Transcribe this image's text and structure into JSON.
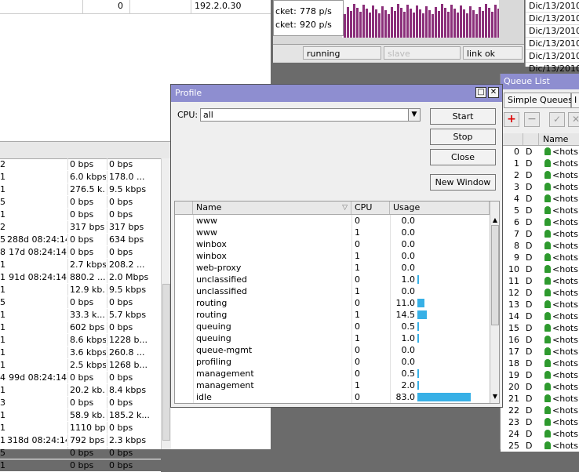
{
  "left_window": {
    "top_row": {
      "count": "0",
      "address": "192.2.0.30"
    },
    "rows": [
      {
        "id": "2",
        "uptime": "",
        "tx": "0 bps",
        "rx": "0 bps"
      },
      {
        "id": "1",
        "uptime": "",
        "tx": "6.0 kbps",
        "rx": "178.0 ..."
      },
      {
        "id": "1",
        "uptime": "",
        "tx": "276.5 k...",
        "rx": "9.5 kbps"
      },
      {
        "id": "5",
        "uptime": "",
        "tx": "0 bps",
        "rx": "0 bps"
      },
      {
        "id": "1",
        "uptime": "",
        "tx": "0 bps",
        "rx": "0 bps"
      },
      {
        "id": "2",
        "uptime": "",
        "tx": "317 bps",
        "rx": "317 bps"
      },
      {
        "id": "5",
        "uptime": "288d 08:24:14",
        "tx": "0 bps",
        "rx": "634 bps"
      },
      {
        "id": "8",
        "uptime": "17d 08:24:14",
        "tx": "0 bps",
        "rx": "0 bps"
      },
      {
        "id": "1",
        "uptime": "",
        "tx": "2.7 kbps",
        "rx": "208.2 ..."
      },
      {
        "id": "1",
        "uptime": "91d 08:24:14",
        "tx": "880.2 ...",
        "rx": "2.0 Mbps"
      },
      {
        "id": "1",
        "uptime": "",
        "tx": "12.9 kb...",
        "rx": "9.5 kbps"
      },
      {
        "id": "5",
        "uptime": "",
        "tx": "0 bps",
        "rx": "0 bps"
      },
      {
        "id": "1",
        "uptime": "",
        "tx": "33.3 k...",
        "rx": "5.7 kbps"
      },
      {
        "id": "1",
        "uptime": "",
        "tx": "602 bps",
        "rx": "0 bps"
      },
      {
        "id": "1",
        "uptime": "",
        "tx": "8.6 kbps",
        "rx": "1228 b..."
      },
      {
        "id": "1",
        "uptime": "",
        "tx": "3.6 kbps",
        "rx": "260.8 ..."
      },
      {
        "id": "1",
        "uptime": "",
        "tx": "2.5 kbps",
        "rx": "1268 b..."
      },
      {
        "id": "4",
        "uptime": "99d 08:24:14",
        "tx": "0 bps",
        "rx": "0 bps"
      },
      {
        "id": "1",
        "uptime": "",
        "tx": "20.2 kb...",
        "rx": "8.4 kbps"
      },
      {
        "id": "3",
        "uptime": "",
        "tx": "0 bps",
        "rx": "0 bps"
      },
      {
        "id": "1",
        "uptime": "",
        "tx": "58.9 kb...",
        "rx": "185.2 k..."
      },
      {
        "id": "1",
        "uptime": "",
        "tx": "1110 bps",
        "rx": "0 bps"
      },
      {
        "id": "1",
        "uptime": "318d 08:24:14",
        "tx": "792 bps",
        "rx": "2.3 kbps"
      },
      {
        "id": "5",
        "uptime": "",
        "tx": "0 bps",
        "rx": "0 bps"
      },
      {
        "id": "1",
        "uptime": "",
        "tx": "0 bps",
        "rx": "0 bps"
      }
    ]
  },
  "graph_window": {
    "legend": [
      {
        "label": "cket:",
        "value": "778 p/s"
      },
      {
        "label": "cket:",
        "value": "920 p/s"
      }
    ],
    "status": {
      "state": "running",
      "slave": "slave",
      "link": "link ok"
    }
  },
  "log_window": {
    "rows": [
      "Dic/13/2010",
      "Dic/13/2010",
      "Dic/13/2010",
      "Dic/13/2010",
      "Dic/13/2010",
      "Dic/13/2010"
    ]
  },
  "queue_window": {
    "title": "Queue List",
    "tabs": [
      "Simple Queues",
      "I"
    ],
    "columns": {
      "flag": "",
      "name": "Name"
    },
    "rows": [
      {
        "num": "0",
        "flag": "D",
        "name": "<hots"
      },
      {
        "num": "1",
        "flag": "D",
        "name": "<hots"
      },
      {
        "num": "2",
        "flag": "D",
        "name": "<hots"
      },
      {
        "num": "3",
        "flag": "D",
        "name": "<hots"
      },
      {
        "num": "4",
        "flag": "D",
        "name": "<hots"
      },
      {
        "num": "5",
        "flag": "D",
        "name": "<hots"
      },
      {
        "num": "6",
        "flag": "D",
        "name": "<hots"
      },
      {
        "num": "7",
        "flag": "D",
        "name": "<hots"
      },
      {
        "num": "8",
        "flag": "D",
        "name": "<hots"
      },
      {
        "num": "9",
        "flag": "D",
        "name": "<hots"
      },
      {
        "num": "10",
        "flag": "D",
        "name": "<hots"
      },
      {
        "num": "11",
        "flag": "D",
        "name": "<hots"
      },
      {
        "num": "12",
        "flag": "D",
        "name": "<hots"
      },
      {
        "num": "13",
        "flag": "D",
        "name": "<hots"
      },
      {
        "num": "14",
        "flag": "D",
        "name": "<hots"
      },
      {
        "num": "15",
        "flag": "D",
        "name": "<hots"
      },
      {
        "num": "16",
        "flag": "D",
        "name": "<hots"
      },
      {
        "num": "17",
        "flag": "D",
        "name": "<hots"
      },
      {
        "num": "18",
        "flag": "D",
        "name": "<hots"
      },
      {
        "num": "19",
        "flag": "D",
        "name": "<hots"
      },
      {
        "num": "20",
        "flag": "D",
        "name": "<hots"
      },
      {
        "num": "21",
        "flag": "D",
        "name": "<hots"
      },
      {
        "num": "22",
        "flag": "D",
        "name": "<hots"
      },
      {
        "num": "23",
        "flag": "D",
        "name": "<hots"
      },
      {
        "num": "24",
        "flag": "D",
        "name": "<hots"
      },
      {
        "num": "25",
        "flag": "D",
        "name": "<hots"
      }
    ]
  },
  "profile": {
    "title": "Profile",
    "cpu_label": "CPU:",
    "cpu_value": "all",
    "buttons": {
      "start": "Start",
      "stop": "Stop",
      "close": "Close",
      "new_window": "New Window"
    },
    "columns": {
      "name": "Name",
      "cpu": "CPU",
      "usage": "Usage"
    },
    "rows": [
      {
        "name": "www",
        "cpu": "0",
        "usage": "0.0",
        "pct": 0
      },
      {
        "name": "www",
        "cpu": "1",
        "usage": "0.0",
        "pct": 0
      },
      {
        "name": "winbox",
        "cpu": "0",
        "usage": "0.0",
        "pct": 0
      },
      {
        "name": "winbox",
        "cpu": "1",
        "usage": "0.0",
        "pct": 0
      },
      {
        "name": "web-proxy",
        "cpu": "1",
        "usage": "0.0",
        "pct": 0
      },
      {
        "name": "unclassified",
        "cpu": "0",
        "usage": "1.0",
        "pct": 1.0
      },
      {
        "name": "unclassified",
        "cpu": "1",
        "usage": "0.0",
        "pct": 0
      },
      {
        "name": "routing",
        "cpu": "0",
        "usage": "11.0",
        "pct": 11.0
      },
      {
        "name": "routing",
        "cpu": "1",
        "usage": "14.5",
        "pct": 14.5
      },
      {
        "name": "queuing",
        "cpu": "0",
        "usage": "0.5",
        "pct": 0.5
      },
      {
        "name": "queuing",
        "cpu": "1",
        "usage": "1.0",
        "pct": 1.0
      },
      {
        "name": "queue-mgmt",
        "cpu": "0",
        "usage": "0.0",
        "pct": 0
      },
      {
        "name": "profiling",
        "cpu": "0",
        "usage": "0.0",
        "pct": 0
      },
      {
        "name": "management",
        "cpu": "0",
        "usage": "0.5",
        "pct": 0.5
      },
      {
        "name": "management",
        "cpu": "1",
        "usage": "2.0",
        "pct": 2.0
      },
      {
        "name": "idle",
        "cpu": "0",
        "usage": "83.0",
        "pct": 83.0
      }
    ]
  },
  "colors": {
    "titlebar": "#8e8ed0",
    "usage_bar": "#37b0e6",
    "graph_bar": "#8b2f7a",
    "queue_icon": "#2e9a2e"
  }
}
